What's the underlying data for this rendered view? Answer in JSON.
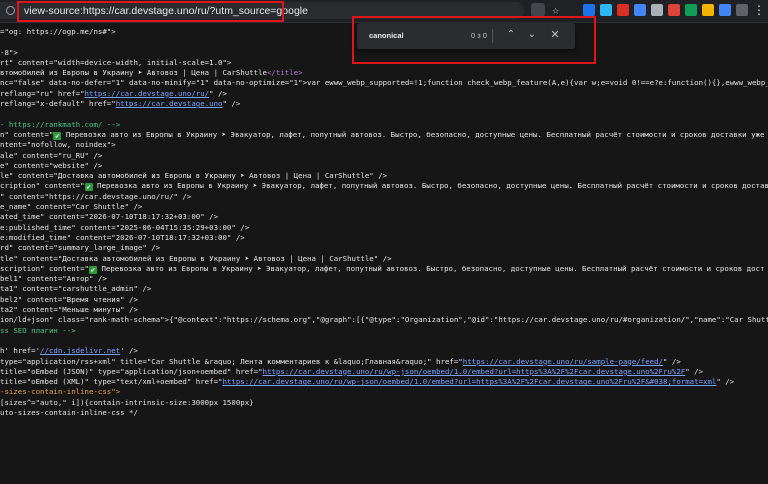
{
  "address_bar": {
    "url": "view-source:https://car.devstage.uno/ru/?utm_source=google"
  },
  "find_bar": {
    "query": "canonical",
    "count": "0 з 0"
  },
  "extension_colors": [
    "#1a73e8",
    "#2db7f5",
    "#d93025",
    "#4285f4",
    "#aab0b7",
    "#db4437",
    "#0f9d58",
    "#f4b400",
    "#4285f4",
    "#5f6368",
    "#e8eaed"
  ],
  "source_lines": [
    [
      {
        "t": "=\"og: https://ogp.me/ns#\">"
      }
    ],
    [],
    [
      {
        "t": "-8\">"
      }
    ],
    [
      {
        "t": "rt\" content=\"width=device-width, initial-scale=1.0\">"
      }
    ],
    [
      {
        "t": "втомобилей из Европы в Украину ➤ Автовоз | Цена | CarShuttle"
      },
      {
        "t": "</title>",
        "c": "c-purple"
      }
    ],
    [
      {
        "t": "nc=\"false\" data-no-defer=\"1\" data-no-minify=\"1\" data-no-optimize=\"1\">var ewww_webp_supported=!1;function check_webp_feature(A,e){var w;e=void 0!==e?e:function(){},ewww_webp_su"
      }
    ],
    [
      {
        "t": "reflang=\"ru\" href=\""
      },
      {
        "t": "https://car.devstage.uno/ru/",
        "c": "c-link"
      },
      {
        "t": "\" />"
      }
    ],
    [
      {
        "t": "reflang=\"x-default\" href=\""
      },
      {
        "t": "https://car.devstage.uno",
        "c": "c-link"
      },
      {
        "t": "\" />"
      }
    ],
    [],
    [
      {
        "t": "- https://rankmath.com/ -->",
        "c": "c-comment"
      }
    ],
    [
      {
        "t": "n\" content=\""
      },
      {
        "t": "✔",
        "c": "c-check"
      },
      {
        "t": " Перевозка авто из Европы в Украину ➤ Эвакуатор, лафет, попутный автовоз. Быстро, безопасно, доступные цены. Бесплатный расчёт стоимости и сроков доставки уже"
      }
    ],
    [
      {
        "t": "ntent=\"nofollow, noindex\">"
      }
    ],
    [
      {
        "t": "ale\" content=\"ru_RU\" />"
      }
    ],
    [
      {
        "t": "e\" content=\"website\" />"
      }
    ],
    [
      {
        "t": "le\" content=\"Доставка автомобилей из Европы в Украину ➤ Автовоз | Цена | CarShuttle\" />"
      }
    ],
    [
      {
        "t": "cription\" content=\""
      },
      {
        "t": "✔",
        "c": "c-check"
      },
      {
        "t": " Перевозка авто из Европы в Украину ➤ Эвакуатор, лафет, попутный автовоз. Быстро, безопасно, доступные цены. Бесплатный расчёт стоимости и сроков достав"
      }
    ],
    [
      {
        "t": "\" content=\"https://car.devstage.uno/ru/\" />"
      }
    ],
    [
      {
        "t": "e_name\" content=\"Car Shuttle\" />"
      }
    ],
    [
      {
        "t": "ated_time\" content=\"2026-07-10T18:17:32+03:00\" />"
      }
    ],
    [
      {
        "t": "e:published_time\" content=\"2025-06-04T15:35:29+03:00\" />"
      }
    ],
    [
      {
        "t": "e:modified_time\" content=\"2026-07-10T18:17:32+03:00\" />"
      }
    ],
    [
      {
        "t": "rd\" content=\"summary_large_image\" />"
      }
    ],
    [
      {
        "t": "tle\" content=\"Доставка автомобилей из Европы в Украину ➤ Автовоз | Цена | CarShuttle\" />"
      }
    ],
    [
      {
        "t": "scription\" content=\""
      },
      {
        "t": "✔",
        "c": "c-check"
      },
      {
        "t": " Перевозка авто из Европы в Украину ➤ Эвакуатор, лафет, попутный автовоз. Быстро, безопасно, доступные цены. Бесплатный расчёт стоимости и сроков дост"
      }
    ],
    [
      {
        "t": "bel1\" content=\"Автор\" />"
      }
    ],
    [
      {
        "t": "ta1\" content=\"carshuttle_admin\" />"
      }
    ],
    [
      {
        "t": "bel2\" content=\"Время чтения\" />"
      }
    ],
    [
      {
        "t": "ta2\" content=\"Меньше минуты\" />"
      }
    ],
    [
      {
        "t": "ion/ld+json\" class=\"rank-math-schema\">{\"@context\":\"https://schema.org\",\"@graph\":[{\"@type\":\"Organization\",\"@id\":\"https://car.devstage.uno/ru/#organization/\",\"name\":\"Car Shuttl"
      }
    ],
    [
      {
        "t": "ss SEO плагин -->",
        "c": "c-comment"
      }
    ],
    [],
    [
      {
        "t": "h' href='"
      },
      {
        "t": "//cdn.jsdelivr.net",
        "c": "c-link"
      },
      {
        "t": "' />"
      }
    ],
    [
      {
        "t": "type=\"application/rss+xml\" title=\"Car Shuttle &raquo; Лента комментариев к &laquo;Главная&raquo;\" href=\""
      },
      {
        "t": "https://car.devstage.uno/ru/sample-page/feed/",
        "c": "c-link"
      },
      {
        "t": "\" />"
      }
    ],
    [
      {
        "t": "title=\"oEmbed (JSON)\" type=\"application/json+oembed\" href=\""
      },
      {
        "t": "https://car.devstage.uno/ru/wp-json/oembed/1.0/embed?url=https%3A%2F%2Fcar.devstage.uno%2Fru%2F",
        "c": "c-link"
      },
      {
        "t": "\" />"
      }
    ],
    [
      {
        "t": "title=\"oEmbed (XML)\" type=\"text/xml+oembed\" href=\""
      },
      {
        "t": "https://car.devstage.uno/ru/wp-json/oembed/1.0/embed?url=https%3A%2F%2Fcar.devstage.uno%2Fru%2F&#038;format=xml",
        "c": "c-link"
      },
      {
        "t": "\" />"
      }
    ],
    [
      {
        "t": "-sizes-contain-inline-css\">",
        "c": "c-orange"
      }
    ],
    [
      {
        "t": "[sizes^=\"auto,\" i]){contain-intrinsic-size:3000px 1500px}"
      }
    ],
    [
      {
        "t": "uto-sizes-contain-inline-css */"
      }
    ]
  ]
}
